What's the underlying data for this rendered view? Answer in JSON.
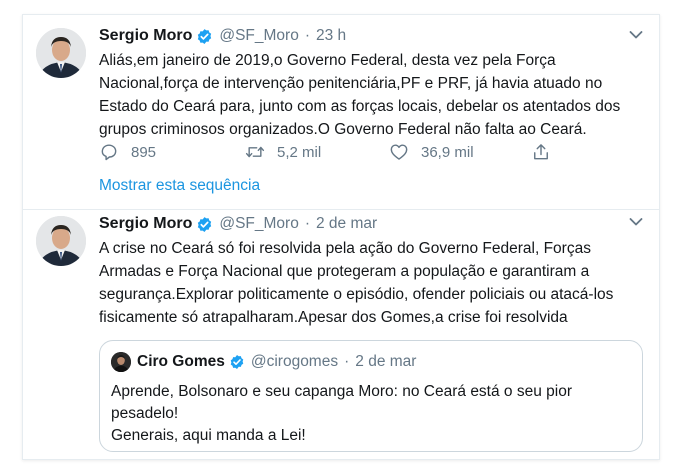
{
  "tweets": [
    {
      "author_name": "Sergio Moro",
      "handle": "@SF_Moro",
      "separator": "·",
      "time": "23 h",
      "text": "Aliás,em janeiro de 2019,o Governo Federal, desta vez pela Força\nNacional,força de intervenção penitenciária,PF e PRF, já havia atuado no\nEstado do Ceará para, junto com as forças locais, debelar os atentados dos\ngrupos criminosos organizados.O Governo Federal não falta ao Ceará.",
      "replies": "895",
      "retweets": "5,2 mil",
      "likes": "36,9 mil",
      "thread_link": "Mostrar esta sequência"
    },
    {
      "author_name": "Sergio Moro",
      "handle": "@SF_Moro",
      "separator": "·",
      "time": "2 de mar",
      "text": "A crise no Ceará só foi resolvida pela ação do Governo Federal, Forças\nArmadas e Força Nacional que protegeram a população e garantiram a\nsegurança.Explorar politicamente o episódio, ofender policiais ou atacá-los\nfisicamente só atrapalharam.Apesar dos Gomes,a crise foi resolvida",
      "quote": {
        "author_name": "Ciro Gomes",
        "handle": "@cirogomes",
        "separator": "·",
        "time": "2 de mar",
        "text": "Aprende, Bolsonaro e seu capanga Moro: no Ceará está o seu pior\npesadelo!\nGenerais, aqui manda a Lei!"
      }
    }
  ],
  "icons": {
    "verified": "verified-badge-icon",
    "caret": "chevron-down-icon",
    "reply": "reply-icon",
    "retweet": "retweet-icon",
    "like": "heart-icon",
    "share": "share-icon"
  },
  "colors": {
    "text": "#14171a",
    "secondary": "#657786",
    "link": "#1b95e0",
    "verified": "#1da1f2",
    "border": "#e6ecf0"
  }
}
